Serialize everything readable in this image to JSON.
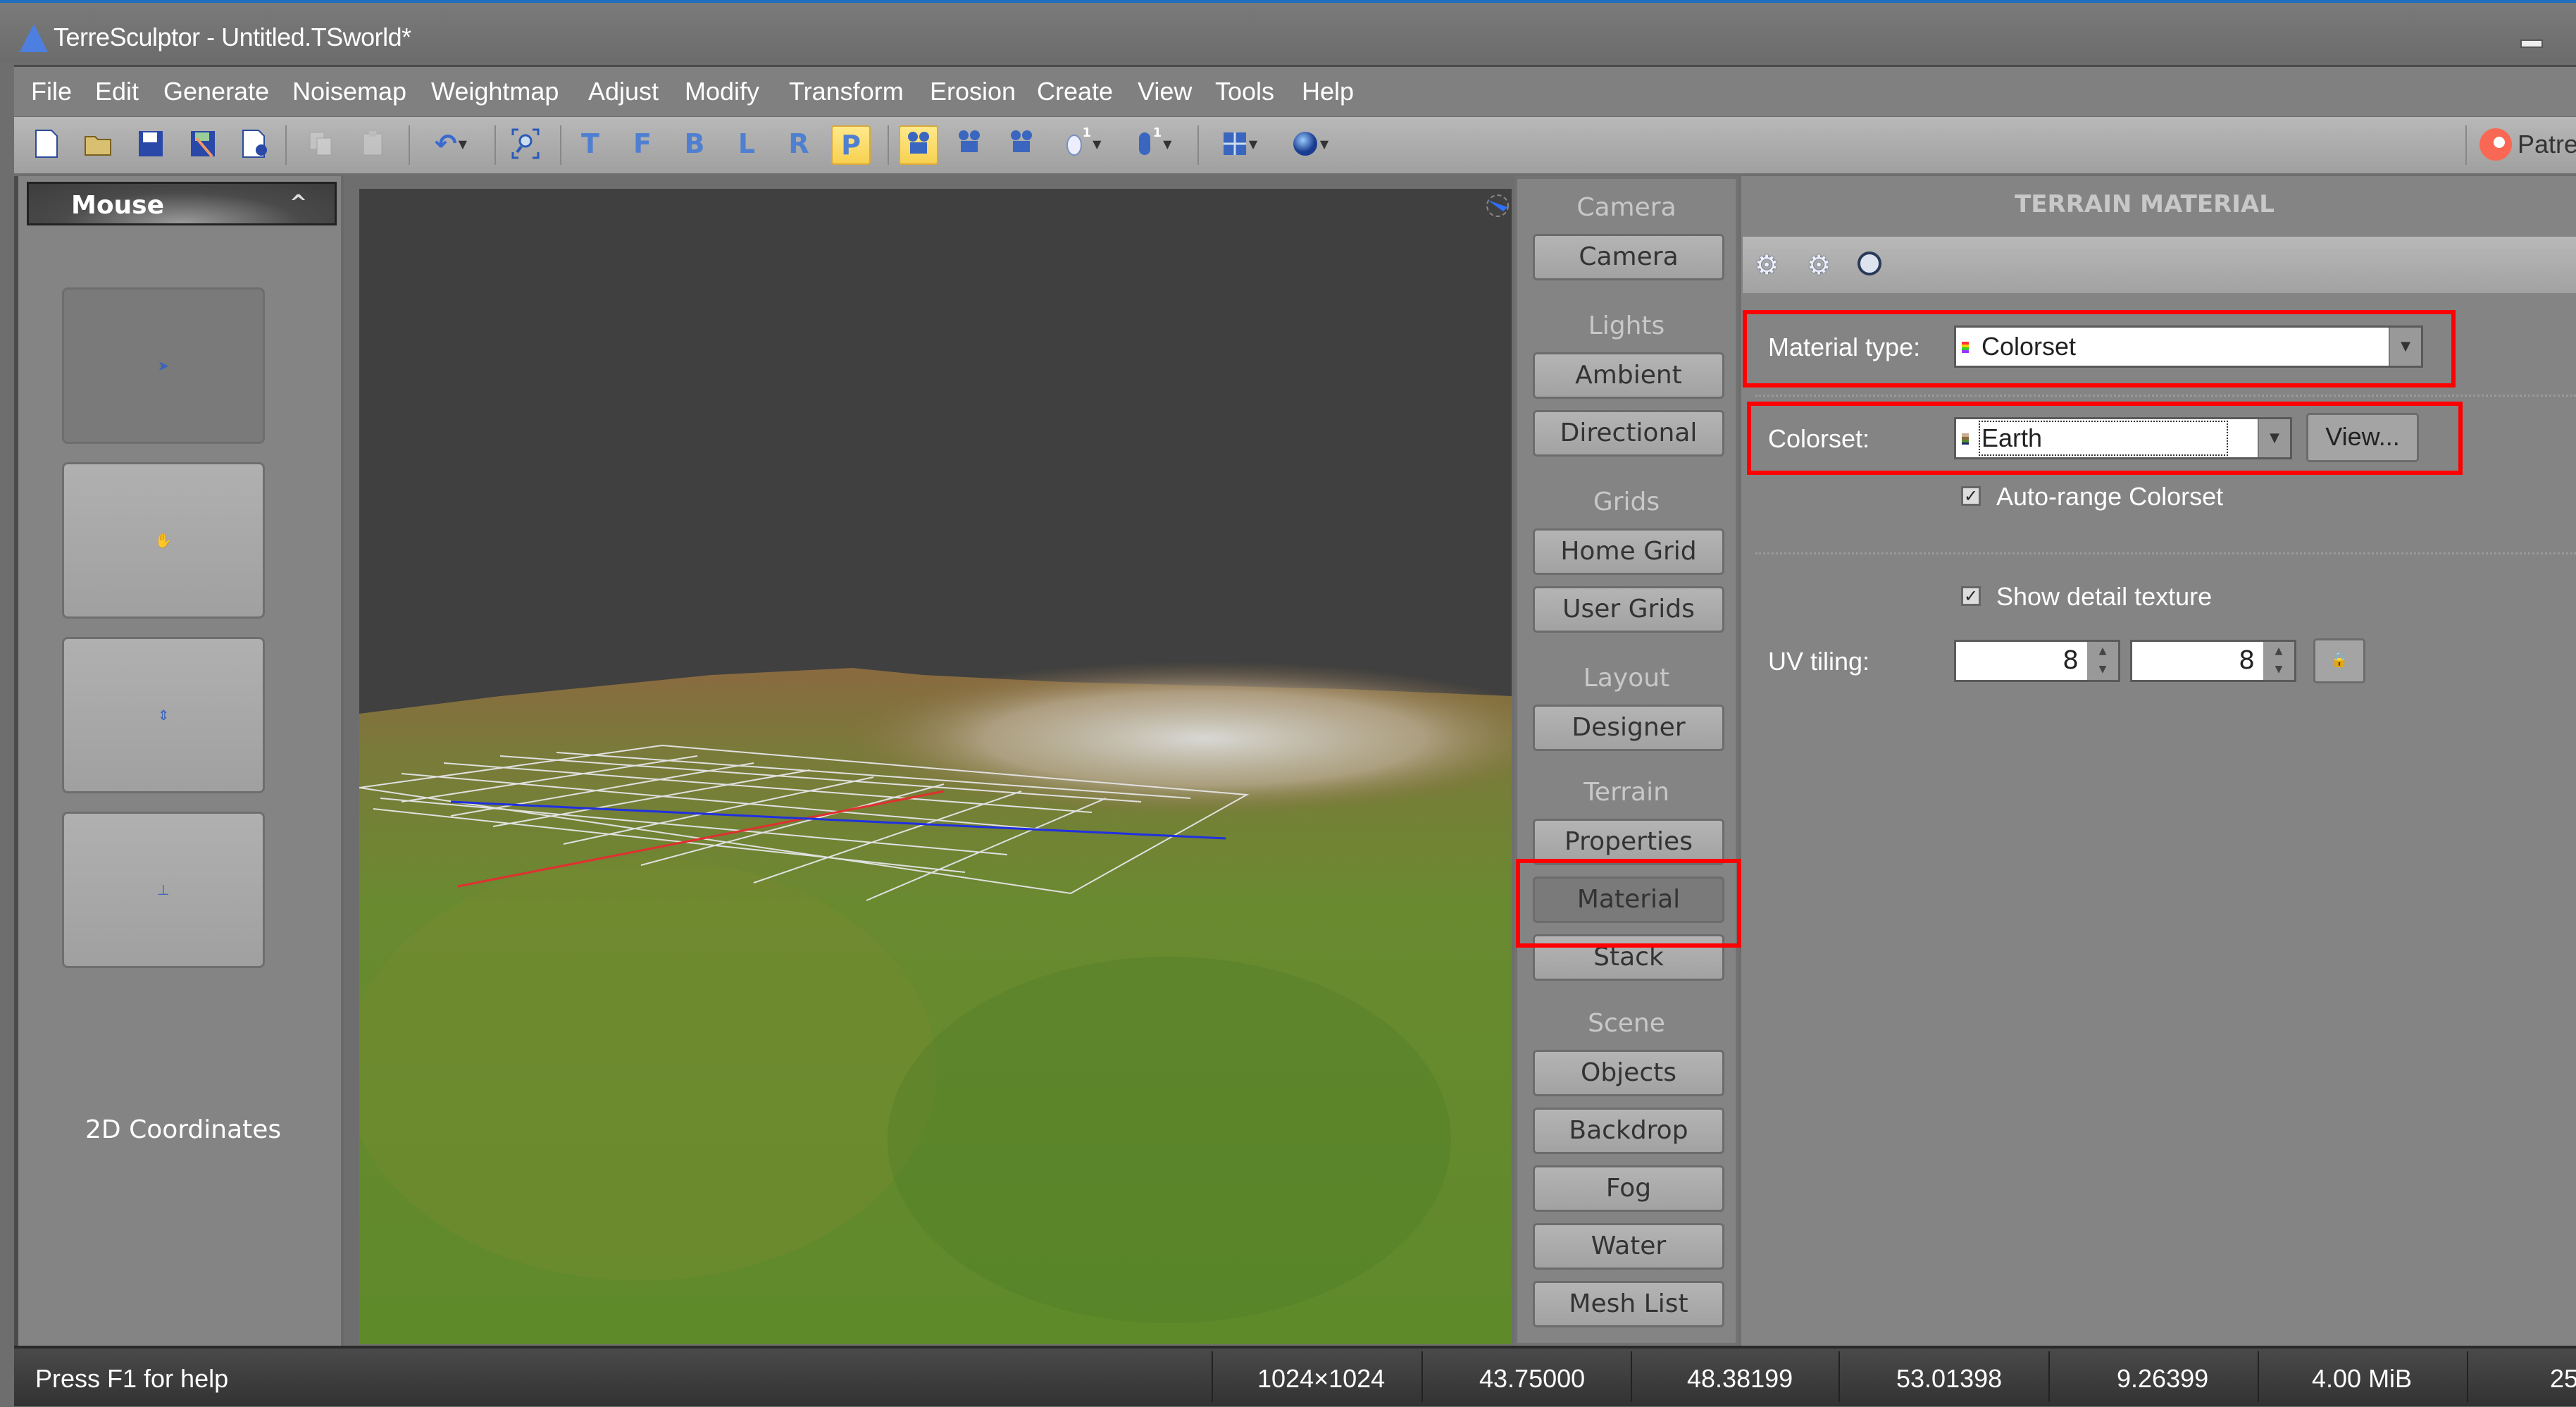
{
  "window": {
    "title": "TerreSculptor - Untitled.TSworld*",
    "app_icon": "mountain-icon"
  },
  "menu": [
    "File",
    "Edit",
    "Generate",
    "Noisemap",
    "Weightmap",
    "Adjust",
    "Modify",
    "Transform",
    "Erosion",
    "Create",
    "View",
    "Tools",
    "Help"
  ],
  "toolbar": {
    "buttons": [
      {
        "icon": "new-file-icon"
      },
      {
        "icon": "open-folder-icon"
      },
      {
        "icon": "save-icon"
      },
      {
        "icon": "save-as-icon"
      },
      {
        "icon": "export-icon"
      },
      {
        "icon": "copy-icon",
        "disabled": true
      },
      {
        "icon": "paste-icon",
        "disabled": true
      },
      {
        "icon": "undo-icon",
        "dropdown": true
      },
      {
        "icon": "zoom-extents-icon"
      },
      {
        "icon": "view-top-icon",
        "label": "T"
      },
      {
        "icon": "view-front-icon",
        "label": "F"
      },
      {
        "icon": "view-back-icon",
        "label": "B"
      },
      {
        "icon": "view-left-icon",
        "label": "L"
      },
      {
        "icon": "view-right-icon",
        "label": "R"
      },
      {
        "icon": "view-perspective-icon",
        "label": "P",
        "active": true
      },
      {
        "icon": "camera-orbit-icon",
        "active": true
      },
      {
        "icon": "camera-fly-icon"
      },
      {
        "icon": "camera-walk-icon"
      },
      {
        "icon": "mouse-mode-icon",
        "badge": "1",
        "dropdown": true
      },
      {
        "icon": "gamepad-mode-icon",
        "badge": "1",
        "dropdown": true
      },
      {
        "icon": "grid-layout-icon",
        "dropdown": true
      },
      {
        "icon": "sphere-shading-icon",
        "dropdown": true
      }
    ],
    "patreon_label": "Patreon"
  },
  "left_panel": {
    "header": "Mouse",
    "tiles": [
      {
        "icon": "arrow-cursor-icon",
        "selected": true
      },
      {
        "icon": "hand-pan-icon",
        "selected": false
      },
      {
        "icon": "vertical-move-icon",
        "selected": false
      },
      {
        "icon": "axis-rotate-icon",
        "selected": false
      }
    ],
    "coords_label": "2D Coordinates"
  },
  "nav_panel": {
    "groups": [
      {
        "heading": "Camera",
        "buttons": [
          "Camera"
        ]
      },
      {
        "heading": "Lights",
        "buttons": [
          "Ambient",
          "Directional"
        ]
      },
      {
        "heading": "Grids",
        "buttons": [
          "Home Grid",
          "User Grids"
        ]
      },
      {
        "heading": "Layout",
        "buttons": [
          "Designer"
        ]
      },
      {
        "heading": "Terrain",
        "buttons": [
          "Properties",
          "Material",
          "Stack"
        ]
      },
      {
        "heading": "Scene",
        "buttons": [
          "Objects",
          "Backdrop",
          "Fog",
          "Water",
          "Mesh List"
        ]
      }
    ],
    "active": "Material"
  },
  "material_panel": {
    "title": "TERRAIN MATERIAL",
    "toolbar_icons": [
      "import-gear-icon",
      "export-gear-icon",
      "reset-circle-icon"
    ],
    "material_type_label": "Material type:",
    "material_type_value": "Colorset",
    "colorset_label": "Colorset:",
    "colorset_value": "Earth",
    "view_button": "View...",
    "auto_range_label": "Auto-range Colorset",
    "auto_range_checked": true,
    "show_detail_label": "Show detail texture",
    "show_detail_checked": true,
    "uv_tiling_label": "UV tiling:",
    "uv_u": "8",
    "uv_v": "8",
    "lock_icon": "lock-icon"
  },
  "highlight_color": "#ff0000",
  "statusbar": {
    "help": "Press F1 for help",
    "cells": [
      "1024×1024",
      "43.75000",
      "48.38199",
      "53.01398",
      "9.26399",
      "4.00 MiB",
      "25"
    ]
  }
}
